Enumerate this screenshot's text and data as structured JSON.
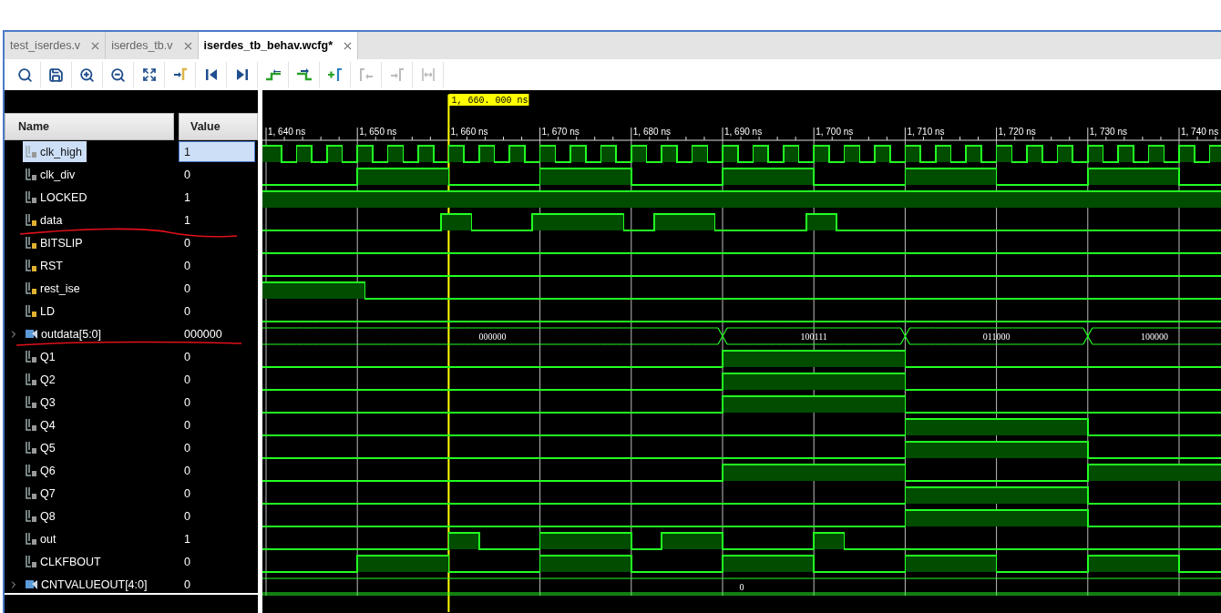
{
  "tabs": [
    {
      "label": "test_iserdes.v",
      "selected": false
    },
    {
      "label": "iserdes_tb.v",
      "selected": false
    },
    {
      "label": "iserdes_tb_behav.wcfg*",
      "selected": true
    }
  ],
  "toolbar": [
    {
      "kind": "search",
      "disabled": false
    },
    {
      "kind": "save",
      "disabled": false
    },
    {
      "kind": "zoom-in",
      "disabled": false
    },
    {
      "kind": "zoom-out",
      "disabled": false
    },
    {
      "kind": "fit",
      "disabled": false
    },
    {
      "kind": "go-cursor",
      "disabled": false
    },
    {
      "kind": "go-start",
      "disabled": false
    },
    {
      "kind": "go-end",
      "disabled": false
    },
    {
      "kind": "prev-transition",
      "disabled": false
    },
    {
      "kind": "next-transition",
      "disabled": false
    },
    {
      "kind": "add-marker",
      "disabled": false
    },
    {
      "kind": "prev-marker",
      "disabled": true
    },
    {
      "kind": "next-marker",
      "disabled": true
    },
    {
      "kind": "swap-markers",
      "disabled": true
    }
  ],
  "columns": {
    "name": "Name",
    "value": "Value"
  },
  "waveform": {
    "cursor": "1, 660. 000 ns",
    "ticks": [
      "1, 640 ns",
      "1, 650 ns",
      "1, 660 ns",
      "1, 670 ns",
      "1, 680 ns",
      "1, 690 ns",
      "1, 700 ns",
      "1, 710 ns",
      "1, 720 ns",
      "1, 730 ns",
      "1, 740 ns"
    ]
  },
  "signals": [
    {
      "name": "clk_high",
      "value": "1",
      "kind": "output",
      "selected": true,
      "high": [
        true,
        true,
        false,
        false,
        true,
        true,
        false,
        false,
        true,
        true,
        false,
        false,
        true,
        true,
        false,
        false,
        true,
        true,
        false,
        false,
        true,
        true,
        false,
        false,
        true,
        true,
        false,
        false,
        true,
        true,
        false,
        false,
        true,
        true,
        false,
        false,
        true,
        true,
        false,
        false,
        true,
        true,
        false,
        false,
        true,
        true,
        false,
        false,
        true,
        true,
        false,
        false,
        true,
        true,
        false,
        false,
        true,
        true,
        false,
        false,
        true,
        true,
        false,
        false,
        true,
        true,
        false,
        false,
        true,
        true,
        false,
        false,
        true,
        true,
        false,
        false,
        true,
        true,
        false,
        false,
        true,
        true,
        false,
        false,
        true,
        true,
        false,
        false,
        true,
        true,
        false,
        false,
        true,
        true,
        false,
        false,
        true,
        true,
        false,
        false,
        true,
        true,
        false,
        false,
        true,
        true,
        false,
        false,
        true,
        true,
        false,
        false,
        true,
        true,
        false,
        false,
        true,
        true,
        false,
        false,
        true,
        true,
        false,
        false,
        true,
        true
      ]
    },
    {
      "name": "clk_div",
      "value": "0",
      "kind": "output",
      "selected": false,
      "high": [
        false,
        false,
        false,
        false,
        false,
        false,
        false,
        false,
        false,
        false,
        false,
        false,
        true,
        true,
        true,
        true,
        true,
        true,
        true,
        true,
        true,
        true,
        true,
        true,
        false,
        false,
        false,
        false,
        false,
        false,
        false,
        false,
        false,
        false,
        false,
        false,
        true,
        true,
        true,
        true,
        true,
        true,
        true,
        true,
        true,
        true,
        true,
        true,
        false,
        false,
        false,
        false,
        false,
        false,
        false,
        false,
        false,
        false,
        false,
        false,
        true,
        true,
        true,
        true,
        true,
        true,
        true,
        true,
        true,
        true,
        true,
        true,
        false,
        false,
        false,
        false,
        false,
        false,
        false,
        false,
        false,
        false,
        false,
        false,
        true,
        true,
        true,
        true,
        true,
        true,
        true,
        true,
        true,
        true,
        true,
        true,
        false,
        false,
        false,
        false,
        false,
        false,
        false,
        false,
        false,
        false,
        false,
        false,
        true,
        true,
        true,
        true,
        true,
        true,
        true,
        true,
        true,
        true,
        true,
        true,
        false
      ]
    },
    {
      "name": "LOCKED",
      "value": "1",
      "kind": "output",
      "selected": false,
      "high": [
        true
      ]
    },
    {
      "name": "data",
      "value": "1",
      "kind": "input",
      "selected": false,
      "high": [
        false,
        false,
        false,
        false,
        false,
        false,
        false,
        false,
        false,
        false,
        false,
        false,
        false,
        false,
        false,
        false,
        false,
        false,
        false,
        false,
        false,
        false,
        false,
        true,
        true,
        true,
        true,
        false,
        false,
        false,
        false,
        false,
        false,
        false,
        false,
        true,
        true,
        true,
        true,
        true,
        true,
        true,
        true,
        true,
        true,
        true,
        true,
        false,
        false,
        false,
        false,
        true,
        true,
        true,
        true,
        true,
        true,
        true,
        true,
        false,
        false,
        false,
        false,
        false,
        false,
        false,
        false,
        false,
        false,
        false,
        false,
        true,
        true,
        true,
        true,
        false
      ]
    },
    {
      "name": "BITSLIP",
      "value": "0",
      "kind": "input",
      "selected": false,
      "high": [
        false
      ]
    },
    {
      "name": "RST",
      "value": "0",
      "kind": "input",
      "selected": false,
      "high": [
        false
      ]
    },
    {
      "name": "rest_ise",
      "value": "0",
      "kind": "input",
      "selected": false,
      "high": [
        true,
        true,
        true,
        true,
        true,
        true,
        true,
        true,
        true,
        true,
        true,
        true,
        true,
        false
      ]
    },
    {
      "name": "LD",
      "value": "0",
      "kind": "input",
      "selected": false,
      "high": [
        false
      ]
    },
    {
      "name": "outdata[5:0]",
      "value": "000000",
      "kind": "bus",
      "selected": false,
      "expanded": false,
      "segments": [
        "000000",
        "100111",
        "011000",
        "100000"
      ],
      "change": [
        false,
        false,
        false,
        false,
        false,
        false,
        false,
        false,
        false,
        false,
        false,
        false,
        false,
        false,
        false,
        false,
        false,
        false,
        false,
        false,
        false,
        false,
        false,
        false,
        false,
        false,
        false,
        false,
        false,
        false,
        false,
        false,
        false,
        false,
        false,
        false,
        false,
        false,
        false,
        false,
        false,
        false,
        false,
        false,
        false,
        false,
        false,
        false,
        false,
        false,
        false,
        false,
        false,
        false,
        false,
        false,
        false,
        false,
        false,
        false,
        true,
        false,
        false,
        false,
        false,
        false,
        false,
        false,
        false,
        false,
        false,
        false,
        false,
        false,
        false,
        false,
        false,
        false,
        false,
        false,
        false,
        false,
        false,
        false,
        true,
        false,
        false,
        false,
        false,
        false,
        false,
        false,
        false,
        false,
        false,
        false,
        false,
        false,
        false,
        false,
        false,
        false,
        false,
        false,
        false,
        false,
        false,
        false,
        true,
        false
      ]
    },
    {
      "name": "Q1",
      "value": "0",
      "kind": "output",
      "selected": false,
      "high": [
        false,
        false,
        false,
        false,
        false,
        false,
        false,
        false,
        false,
        false,
        false,
        false,
        false,
        false,
        false,
        false,
        false,
        false,
        false,
        false,
        false,
        false,
        false,
        false,
        false,
        false,
        false,
        false,
        false,
        false,
        false,
        false,
        false,
        false,
        false,
        false,
        false,
        false,
        false,
        false,
        false,
        false,
        false,
        false,
        false,
        false,
        false,
        false,
        false,
        false,
        false,
        false,
        false,
        false,
        false,
        false,
        false,
        false,
        false,
        false,
        true,
        true,
        true,
        true,
        true,
        true,
        true,
        true,
        true,
        true,
        true,
        true,
        true,
        true,
        true,
        true,
        true,
        true,
        true,
        true,
        true,
        true,
        true,
        true,
        false
      ]
    },
    {
      "name": "Q2",
      "value": "0",
      "kind": "output",
      "selected": false,
      "high": [
        false,
        false,
        false,
        false,
        false,
        false,
        false,
        false,
        false,
        false,
        false,
        false,
        false,
        false,
        false,
        false,
        false,
        false,
        false,
        false,
        false,
        false,
        false,
        false,
        false,
        false,
        false,
        false,
        false,
        false,
        false,
        false,
        false,
        false,
        false,
        false,
        false,
        false,
        false,
        false,
        false,
        false,
        false,
        false,
        false,
        false,
        false,
        false,
        false,
        false,
        false,
        false,
        false,
        false,
        false,
        false,
        false,
        false,
        false,
        false,
        true,
        true,
        true,
        true,
        true,
        true,
        true,
        true,
        true,
        true,
        true,
        true,
        true,
        true,
        true,
        true,
        true,
        true,
        true,
        true,
        true,
        true,
        true,
        true,
        false
      ]
    },
    {
      "name": "Q3",
      "value": "0",
      "kind": "output",
      "selected": false,
      "high": [
        false,
        false,
        false,
        false,
        false,
        false,
        false,
        false,
        false,
        false,
        false,
        false,
        false,
        false,
        false,
        false,
        false,
        false,
        false,
        false,
        false,
        false,
        false,
        false,
        false,
        false,
        false,
        false,
        false,
        false,
        false,
        false,
        false,
        false,
        false,
        false,
        false,
        false,
        false,
        false,
        false,
        false,
        false,
        false,
        false,
        false,
        false,
        false,
        false,
        false,
        false,
        false,
        false,
        false,
        false,
        false,
        false,
        false,
        false,
        false,
        true,
        true,
        true,
        true,
        true,
        true,
        true,
        true,
        true,
        true,
        true,
        true,
        true,
        true,
        true,
        true,
        true,
        true,
        true,
        true,
        true,
        true,
        true,
        true,
        false
      ]
    },
    {
      "name": "Q4",
      "value": "0",
      "kind": "output",
      "selected": false,
      "high": [
        false,
        false,
        false,
        false,
        false,
        false,
        false,
        false,
        false,
        false,
        false,
        false,
        false,
        false,
        false,
        false,
        false,
        false,
        false,
        false,
        false,
        false,
        false,
        false,
        false,
        false,
        false,
        false,
        false,
        false,
        false,
        false,
        false,
        false,
        false,
        false,
        false,
        false,
        false,
        false,
        false,
        false,
        false,
        false,
        false,
        false,
        false,
        false,
        false,
        false,
        false,
        false,
        false,
        false,
        false,
        false,
        false,
        false,
        false,
        false,
        false,
        false,
        false,
        false,
        false,
        false,
        false,
        false,
        false,
        false,
        false,
        false,
        false,
        false,
        false,
        false,
        false,
        false,
        false,
        false,
        false,
        false,
        false,
        false,
        true,
        true,
        true,
        true,
        true,
        true,
        true,
        true,
        true,
        true,
        true,
        true,
        true,
        true,
        true,
        true,
        true,
        true,
        true,
        true,
        true,
        true,
        true,
        true,
        false
      ]
    },
    {
      "name": "Q5",
      "value": "0",
      "kind": "output",
      "selected": false,
      "high": [
        false,
        false,
        false,
        false,
        false,
        false,
        false,
        false,
        false,
        false,
        false,
        false,
        false,
        false,
        false,
        false,
        false,
        false,
        false,
        false,
        false,
        false,
        false,
        false,
        false,
        false,
        false,
        false,
        false,
        false,
        false,
        false,
        false,
        false,
        false,
        false,
        false,
        false,
        false,
        false,
        false,
        false,
        false,
        false,
        false,
        false,
        false,
        false,
        false,
        false,
        false,
        false,
        false,
        false,
        false,
        false,
        false,
        false,
        false,
        false,
        false,
        false,
        false,
        false,
        false,
        false,
        false,
        false,
        false,
        false,
        false,
        false,
        false,
        false,
        false,
        false,
        false,
        false,
        false,
        false,
        false,
        false,
        false,
        false,
        true,
        true,
        true,
        true,
        true,
        true,
        true,
        true,
        true,
        true,
        true,
        true,
        true,
        true,
        true,
        true,
        true,
        true,
        true,
        true,
        true,
        true,
        true,
        true,
        false
      ]
    },
    {
      "name": "Q6",
      "value": "0",
      "kind": "output",
      "selected": false,
      "high": [
        false,
        false,
        false,
        false,
        false,
        false,
        false,
        false,
        false,
        false,
        false,
        false,
        false,
        false,
        false,
        false,
        false,
        false,
        false,
        false,
        false,
        false,
        false,
        false,
        false,
        false,
        false,
        false,
        false,
        false,
        false,
        false,
        false,
        false,
        false,
        false,
        false,
        false,
        false,
        false,
        false,
        false,
        false,
        false,
        false,
        false,
        false,
        false,
        false,
        false,
        false,
        false,
        false,
        false,
        false,
        false,
        false,
        false,
        false,
        false,
        true,
        true,
        true,
        true,
        true,
        true,
        true,
        true,
        true,
        true,
        true,
        true,
        true,
        true,
        true,
        true,
        true,
        true,
        true,
        true,
        true,
        true,
        true,
        true,
        false,
        false,
        false,
        false,
        false,
        false,
        false,
        false,
        false,
        false,
        false,
        false,
        false,
        false,
        false,
        false,
        false,
        false,
        false,
        false,
        false,
        false,
        false,
        false,
        true
      ]
    },
    {
      "name": "Q7",
      "value": "0",
      "kind": "output",
      "selected": false,
      "high": [
        false,
        false,
        false,
        false,
        false,
        false,
        false,
        false,
        false,
        false,
        false,
        false,
        false,
        false,
        false,
        false,
        false,
        false,
        false,
        false,
        false,
        false,
        false,
        false,
        false,
        false,
        false,
        false,
        false,
        false,
        false,
        false,
        false,
        false,
        false,
        false,
        false,
        false,
        false,
        false,
        false,
        false,
        false,
        false,
        false,
        false,
        false,
        false,
        false,
        false,
        false,
        false,
        false,
        false,
        false,
        false,
        false,
        false,
        false,
        false,
        false,
        false,
        false,
        false,
        false,
        false,
        false,
        false,
        false,
        false,
        false,
        false,
        false,
        false,
        false,
        false,
        false,
        false,
        false,
        false,
        false,
        false,
        false,
        false,
        true,
        true,
        true,
        true,
        true,
        true,
        true,
        true,
        true,
        true,
        true,
        true,
        true,
        true,
        true,
        true,
        true,
        true,
        true,
        true,
        true,
        true,
        true,
        true,
        false
      ]
    },
    {
      "name": "Q8",
      "value": "0",
      "kind": "output",
      "selected": false,
      "high": [
        false,
        false,
        false,
        false,
        false,
        false,
        false,
        false,
        false,
        false,
        false,
        false,
        false,
        false,
        false,
        false,
        false,
        false,
        false,
        false,
        false,
        false,
        false,
        false,
        false,
        false,
        false,
        false,
        false,
        false,
        false,
        false,
        false,
        false,
        false,
        false,
        false,
        false,
        false,
        false,
        false,
        false,
        false,
        false,
        false,
        false,
        false,
        false,
        false,
        false,
        false,
        false,
        false,
        false,
        false,
        false,
        false,
        false,
        false,
        false,
        false,
        false,
        false,
        false,
        false,
        false,
        false,
        false,
        false,
        false,
        false,
        false,
        false,
        false,
        false,
        false,
        false,
        false,
        false,
        false,
        false,
        false,
        false,
        false,
        true,
        true,
        true,
        true,
        true,
        true,
        true,
        true,
        true,
        true,
        true,
        true,
        true,
        true,
        true,
        true,
        true,
        true,
        true,
        true,
        true,
        true,
        true,
        true,
        false
      ]
    },
    {
      "name": "out",
      "value": "1",
      "kind": "output",
      "selected": false,
      "high": [
        false,
        false,
        false,
        false,
        false,
        false,
        false,
        false,
        false,
        false,
        false,
        false,
        false,
        false,
        false,
        false,
        false,
        false,
        false,
        false,
        false,
        false,
        false,
        false,
        true,
        true,
        true,
        true,
        false,
        false,
        false,
        false,
        false,
        false,
        false,
        false,
        true,
        true,
        true,
        true,
        true,
        true,
        true,
        true,
        true,
        true,
        true,
        true,
        false,
        false,
        false,
        false,
        true,
        true,
        true,
        true,
        true,
        true,
        true,
        true,
        false,
        false,
        false,
        false,
        false,
        false,
        false,
        false,
        false,
        false,
        false,
        false,
        true,
        true,
        true,
        true,
        false
      ]
    },
    {
      "name": "CLKFBOUT",
      "value": "0",
      "kind": "output",
      "selected": false,
      "high": [
        false,
        false,
        false,
        false,
        false,
        false,
        false,
        false,
        false,
        false,
        false,
        false,
        true,
        true,
        true,
        true,
        true,
        true,
        true,
        true,
        true,
        true,
        true,
        true,
        false,
        false,
        false,
        false,
        false,
        false,
        false,
        false,
        false,
        false,
        false,
        false,
        true,
        true,
        true,
        true,
        true,
        true,
        true,
        true,
        true,
        true,
        true,
        true,
        false,
        false,
        false,
        false,
        false,
        false,
        false,
        false,
        false,
        false,
        false,
        false,
        true,
        true,
        true,
        true,
        true,
        true,
        true,
        true,
        true,
        true,
        true,
        true,
        false,
        false,
        false,
        false,
        false,
        false,
        false,
        false,
        false,
        false,
        false,
        false,
        true,
        true,
        true,
        true,
        true,
        true,
        true,
        true,
        true,
        true,
        true,
        true,
        false,
        false,
        false,
        false,
        false,
        false,
        false,
        false,
        false,
        false,
        false,
        false,
        true,
        true,
        true,
        true,
        true,
        true,
        true,
        true,
        true,
        true,
        true,
        true,
        false
      ]
    },
    {
      "name": "CNTVALUEOUT[4:0]",
      "value": "0",
      "kind": "bus",
      "selected": false,
      "expanded": false,
      "segments": [
        "0"
      ]
    }
  ]
}
